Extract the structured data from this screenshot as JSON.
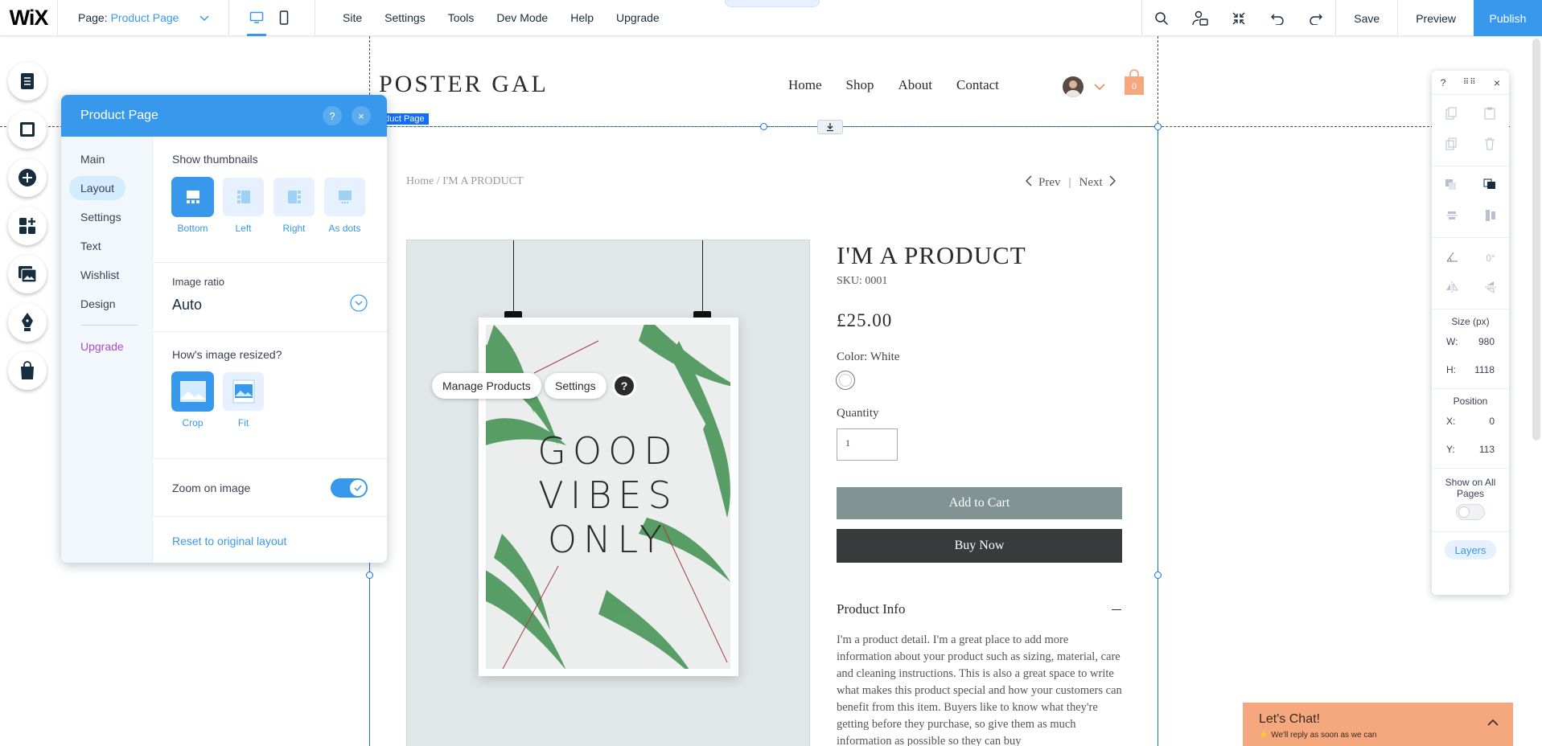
{
  "topbar": {
    "logo": "WiX",
    "page_label": "Page:",
    "page_value": "Product Page",
    "menus": [
      "Site",
      "Settings",
      "Tools",
      "Dev Mode",
      "Help",
      "Upgrade"
    ],
    "save": "Save",
    "preview": "Preview",
    "publish": "Publish",
    "accent": "#3899ec"
  },
  "site": {
    "logo": "POSTER GAL",
    "nav": [
      "Home",
      "Shop",
      "About",
      "Contact"
    ],
    "cart_count": "0",
    "selection_tag": "Product Page",
    "breadcrumb": "Home / I'M A PRODUCT",
    "prev": "Prev",
    "next": "Next",
    "poster_lines": [
      "GOOD",
      "VIBES",
      "ONLY"
    ],
    "product_title": "I'M A PRODUCT",
    "sku": "SKU: 0001",
    "price": "£25.00",
    "color_label": "Color: White",
    "quantity_label": "Quantity",
    "quantity_value": "1",
    "add_to_cart": "Add to Cart",
    "buy_now": "Buy Now",
    "info_title": "Product Info",
    "info_body": "I'm a product detail. I'm a great place to add more information about your product such as sizing, material, care and cleaning instructions. This is also a great space to write what makes this product special and how your customers can benefit from this item. Buyers like to know what they're getting before they purchase, so give them as much information as possible so they can buy"
  },
  "floating": {
    "manage_products": "Manage Products",
    "settings": "Settings",
    "help": "?"
  },
  "panel": {
    "title": "Product Page",
    "help": "?",
    "close": "×",
    "nav": [
      "Main",
      "Layout",
      "Settings",
      "Text",
      "Wishlist",
      "Design"
    ],
    "upgrade": "Upgrade",
    "show_thumbnails": "Show thumbnails",
    "thumb_options": [
      "Bottom",
      "Left",
      "Right",
      "As dots"
    ],
    "image_ratio_label": "Image ratio",
    "image_ratio_value": "Auto",
    "resize_label": "How's image resized?",
    "resize_options": [
      "Crop",
      "Fit"
    ],
    "zoom_label": "Zoom on image",
    "reset": "Reset to original layout"
  },
  "inspector": {
    "help": "?",
    "close": "×",
    "angle": "0°",
    "size_label": "Size (px)",
    "w_label": "W:",
    "w_value": "980",
    "h_label": "H:",
    "h_value": "1118",
    "position_label": "Position",
    "x_label": "X:",
    "x_value": "0",
    "y_label": "Y:",
    "y_value": "113",
    "show_all_pages": "Show on All Pages",
    "layers": "Layers"
  },
  "chat": {
    "title": "Let's Chat!",
    "subtitle": "We'll reply as soon as we can"
  }
}
